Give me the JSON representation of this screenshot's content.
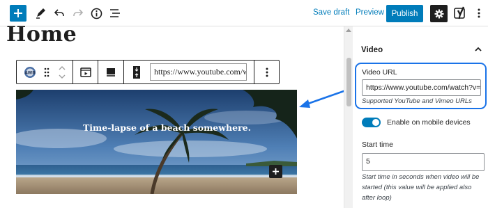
{
  "toolbar": {
    "add_icon": "plus-icon",
    "tools_icon": "pencil-icon",
    "undo_icon": "undo-icon",
    "redo_icon": "redo-icon",
    "info_icon": "info-icon",
    "outline_icon": "list-view-icon",
    "save_draft_label": "Save draft",
    "preview_label": "Preview",
    "publish_label": "Publish",
    "settings_icon": "gear-icon",
    "yoast_icon": "yoast-icon",
    "more_icon": "vertical-ellipsis-icon",
    "accent_color": "#007cba"
  },
  "editor": {
    "page_title": "Home",
    "block_toolbar": {
      "block_icon": "video-block-icon",
      "drag_icon": "drag-handle-icon",
      "move_icon": "move-up-down-icon",
      "btn1_icon": "video-player-icon",
      "btn2_icon": "monitor-icon",
      "btn3_icon": "vertical-align-icon",
      "url_value": "https://www.youtube.com/watch",
      "more_icon": "vertical-ellipsis-icon"
    },
    "video": {
      "caption": "Time-lapse of a beach somewhere.",
      "add_icon": "plus-icon"
    }
  },
  "sidebar": {
    "panel_title": "Video",
    "collapse_icon": "chevron-up-icon",
    "video_url_label": "Video URL",
    "video_url_value": "https://www.youtube.com/watch?v=lo",
    "video_url_help": "Supported YouTube and Vimeo URLs",
    "mobile_toggle_label": "Enable on mobile devices",
    "mobile_toggle_on": true,
    "start_time_label": "Start time",
    "start_time_value": "5",
    "start_time_help_1": "Start time in seconds when video will be",
    "start_time_help_2": "started (this value will be applied also",
    "start_time_help_3": "after loop)",
    "highlight_color": "#1a73e8"
  }
}
